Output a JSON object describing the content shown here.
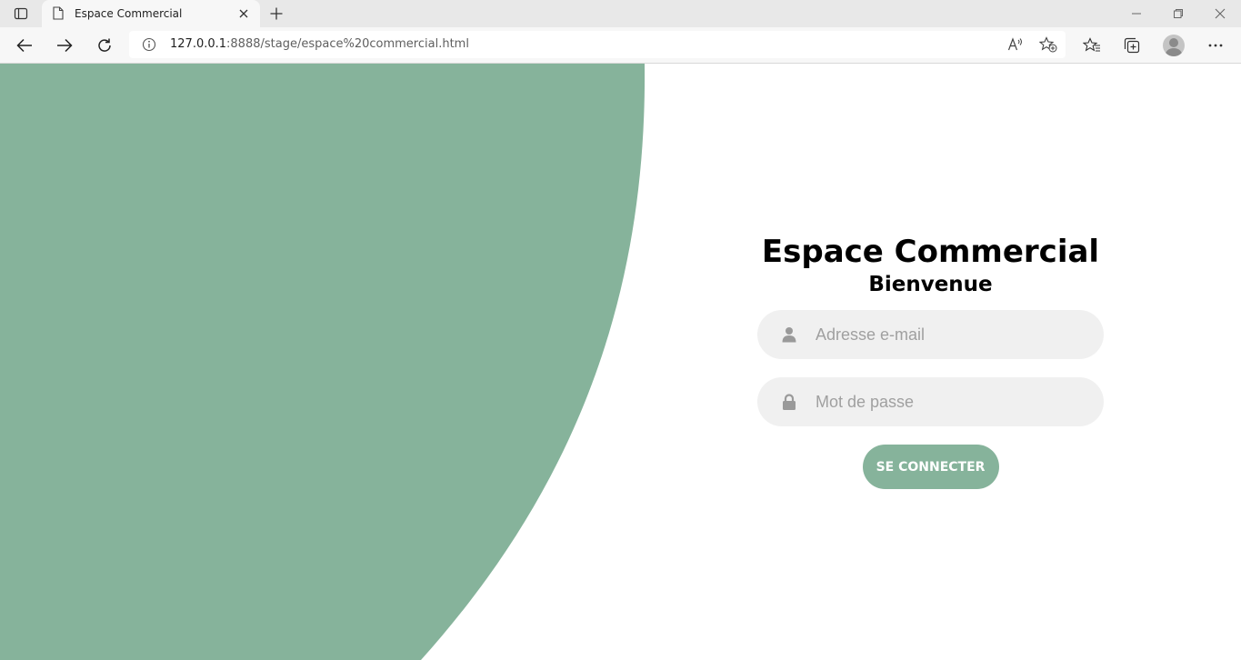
{
  "browser": {
    "tab_title": "Espace Commercial",
    "url_host": "127.0.0.1",
    "url_rest": ":8888/stage/espace%20commercial.html",
    "icons": {
      "tab_actions": "tab-actions-icon",
      "page": "page-icon",
      "close_tab": "close-icon",
      "new_tab": "plus-icon",
      "minimize": "minimize-icon",
      "restore": "restore-icon",
      "close_window": "close-icon",
      "back": "back-arrow-icon",
      "forward": "forward-arrow-icon",
      "refresh": "refresh-icon",
      "site_info": "info-icon",
      "read_aloud": "read-aloud-icon",
      "add_favorite": "star-plus-icon",
      "favorites": "favorites-icon",
      "collections": "collections-icon",
      "profile": "profile-icon",
      "more": "more-icon"
    }
  },
  "page": {
    "accent_color": "#86b39b",
    "title": "Espace Commercial",
    "subtitle": "Bienvenue",
    "email_placeholder": "Adresse e-mail",
    "password_placeholder": "Mot de passe",
    "submit_label": "SE CONNECTER",
    "icons": {
      "email": "user-icon",
      "password": "lock-icon"
    }
  }
}
